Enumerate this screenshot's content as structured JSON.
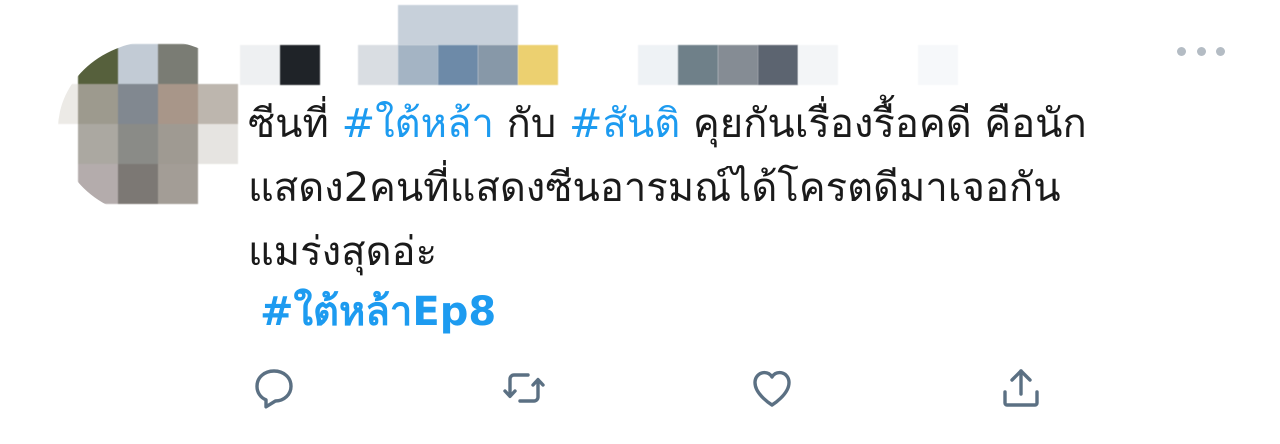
{
  "tweet": {
    "text_lines": [
      {
        "segments": [
          {
            "text": "ซีนที่ ",
            "kind": "plain"
          },
          {
            "text": "#ใต้หล้า",
            "kind": "hashtag"
          },
          {
            "text": " กับ ",
            "kind": "plain"
          },
          {
            "text": "#สันติ",
            "kind": "hashtag"
          },
          {
            "text": " คุยกันเรื่องรื้อคดี คือนัก",
            "kind": "plain"
          }
        ]
      },
      {
        "segments": [
          {
            "text": "แสดง2คนที่แสดงซีนอารมณ์ได้โครตดีมาเจอกัน",
            "kind": "plain"
          }
        ]
      },
      {
        "segments": [
          {
            "text": "แมร่งสุดอ่ะ",
            "kind": "plain"
          }
        ]
      }
    ],
    "bottom_hashtag": "#ใต้หล้าEp8"
  },
  "actions": [
    {
      "name": "reply",
      "icon": "reply-icon"
    },
    {
      "name": "retweet",
      "icon": "retweet-icon"
    },
    {
      "name": "like",
      "icon": "heart-icon"
    },
    {
      "name": "share",
      "icon": "share-icon"
    }
  ],
  "colors": {
    "hashtag": "#1d9bf0",
    "text": "#1a1a1a",
    "icon": "#5b7083",
    "more": "#b4bcc4"
  }
}
